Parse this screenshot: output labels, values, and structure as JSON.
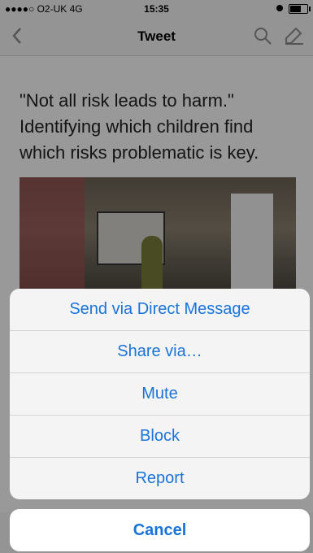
{
  "status_bar": {
    "carrier": "●●●●○ O2-UK  4G",
    "time": "15:35"
  },
  "nav": {
    "title": "Tweet"
  },
  "tweet": {
    "text": "\"Not all risk leads to harm.\" Identifying which children find which risks problematic is key."
  },
  "action_sheet": {
    "items": [
      {
        "label": "Send via Direct Message"
      },
      {
        "label": "Share via…"
      },
      {
        "label": "Mute"
      },
      {
        "label": "Block"
      },
      {
        "label": "Report"
      }
    ],
    "cancel_label": "Cancel"
  },
  "colors": {
    "accent": "#1a73d9",
    "overlay": "rgba(0,0,0,0.40)"
  }
}
